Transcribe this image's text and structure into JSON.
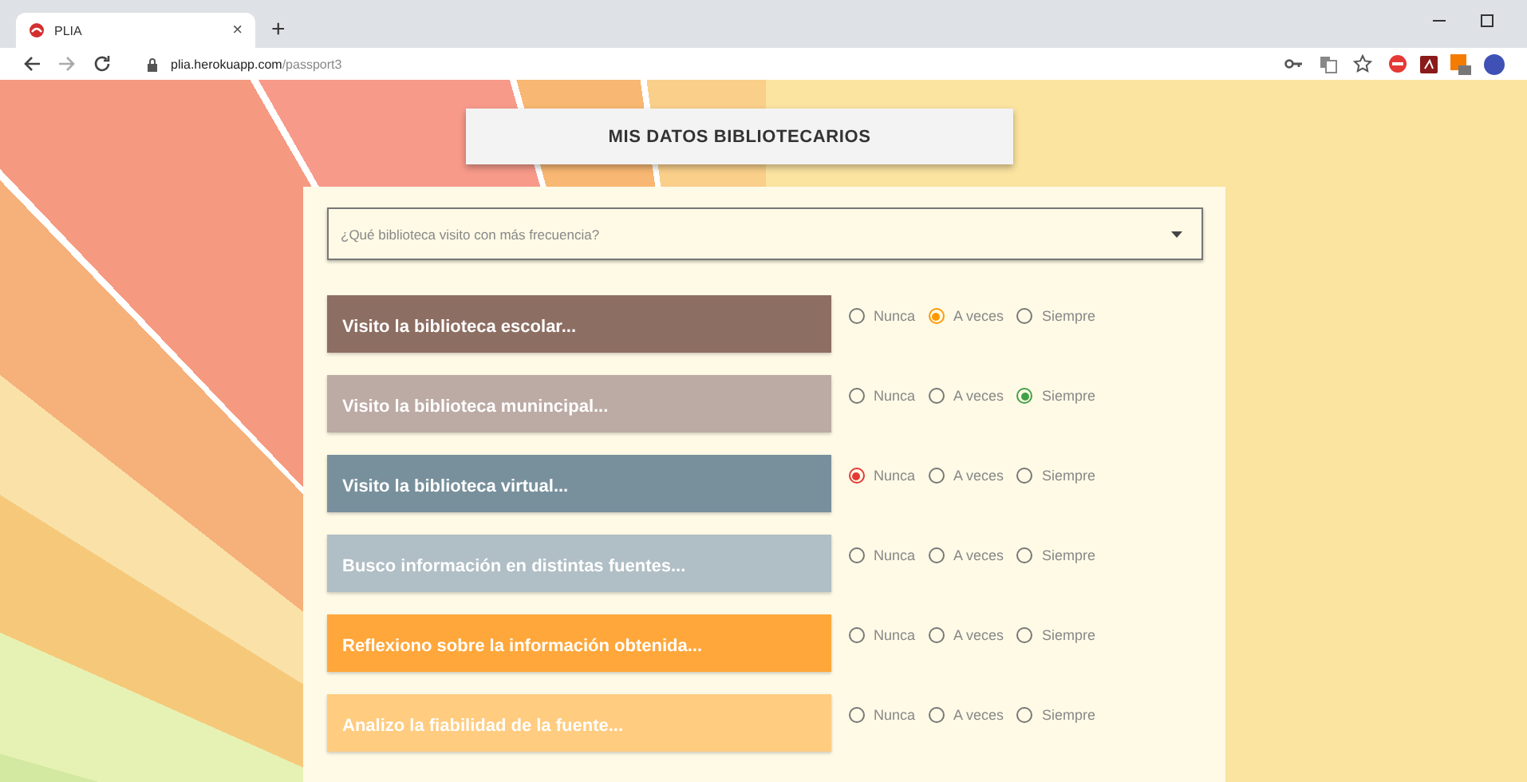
{
  "browser": {
    "tab_title": "PLIA",
    "tab_close": "×",
    "new_tab": "+",
    "url_host": "plia.herokuapp.com",
    "url_path": "/passport3"
  },
  "page": {
    "title": "MIS DATOS BIBLIOTECARIOS",
    "select": {
      "placeholder": "¿Qué biblioteca visito con más frecuencia?"
    },
    "questions": [
      {
        "label": "Visito la biblioteca escolar...",
        "color": "#8d6e63",
        "options": [
          {
            "label": "Nunca",
            "selected": false
          },
          {
            "label": "A veces",
            "selected": true
          },
          {
            "label": "Siempre",
            "selected": false
          }
        ]
      },
      {
        "label": "Visito la biblioteca munincipal...",
        "color": "#bcaaa4",
        "options": [
          {
            "label": "Nunca",
            "selected": false
          },
          {
            "label": "A veces",
            "selected": false
          },
          {
            "label": "Siempre",
            "selected": true
          }
        ]
      },
      {
        "label": "Visito la biblioteca virtual...",
        "color": "#78909c",
        "options": [
          {
            "label": "Nunca",
            "selected": true
          },
          {
            "label": "A veces",
            "selected": false
          },
          {
            "label": "Siempre",
            "selected": false
          }
        ]
      },
      {
        "label": "Busco información en distintas fuentes...",
        "color": "#b0bec5",
        "options": [
          {
            "label": "Nunca",
            "selected": false
          },
          {
            "label": "A veces",
            "selected": false
          },
          {
            "label": "Siempre",
            "selected": false
          }
        ]
      },
      {
        "label": "Reflexiono sobre la información obtenida...",
        "color": "#ffa73a",
        "options": [
          {
            "label": "Nunca",
            "selected": false
          },
          {
            "label": "A veces",
            "selected": false
          },
          {
            "label": "Siempre",
            "selected": false
          }
        ]
      },
      {
        "label": "Analizo la fiabilidad de la fuente...",
        "color": "#ffcc80",
        "options": [
          {
            "label": "Nunca",
            "selected": false
          },
          {
            "label": "A veces",
            "selected": false
          },
          {
            "label": "Siempre",
            "selected": false
          }
        ]
      }
    ]
  }
}
